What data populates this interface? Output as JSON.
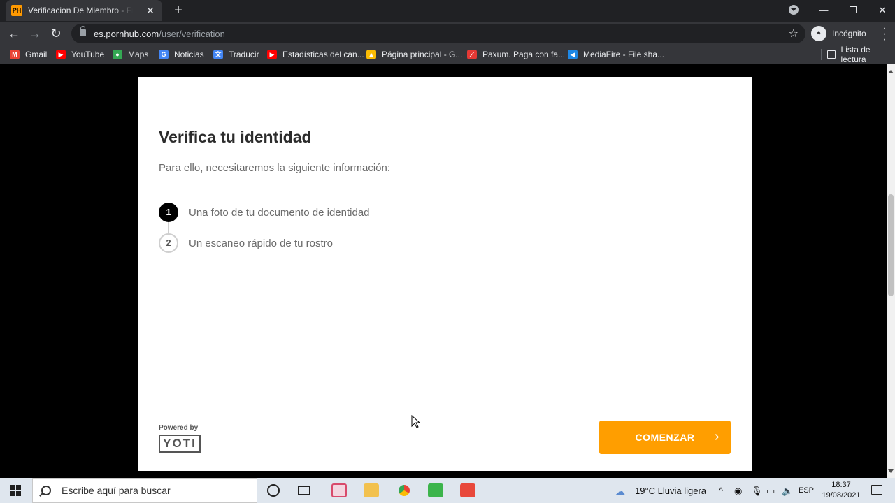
{
  "browser": {
    "tab": {
      "favicon": "PH",
      "title": "Verificacion De Miembro - Free Porn",
      "close": "✕"
    },
    "new_tab": "+",
    "window_controls": {
      "minimize": "—",
      "restore": "❐",
      "close": "✕"
    },
    "url": {
      "host": "es.pornhub.com",
      "path": "/user/verification"
    },
    "profile_label": "Incógnito",
    "bookmarks": [
      {
        "label": "Gmail",
        "color": "#ea4335",
        "glyph": "M"
      },
      {
        "label": "YouTube",
        "color": "#ff0000",
        "glyph": "▶"
      },
      {
        "label": "Maps",
        "color": "#34a853",
        "glyph": "⬤"
      },
      {
        "label": "Noticias",
        "color": "#4285f4",
        "glyph": "G"
      },
      {
        "label": "Traducir",
        "color": "#4285f4",
        "glyph": "文"
      },
      {
        "label": "Estadísticas del can...",
        "color": "#ff0000",
        "glyph": "▶"
      },
      {
        "label": "Página principal - G...",
        "color": "#fbbc04",
        "glyph": "▲"
      },
      {
        "label": "Paxum. Paga con fa...",
        "color": "#e53935",
        "glyph": "⟋"
      },
      {
        "label": "MediaFire - File sha...",
        "color": "#1e88e5",
        "glyph": "◀"
      }
    ],
    "reading_list": "Lista de lectura"
  },
  "verification": {
    "heading": "Verifica tu identidad",
    "subtitle": "Para ello, necesitaremos la siguiente información:",
    "steps": [
      {
        "number": "1",
        "label": "Una foto de tu documento de identidad"
      },
      {
        "number": "2",
        "label": "Un escaneo rápido de tu rostro"
      }
    ],
    "powered_by": "Powered by",
    "provider_logo": "YOTI",
    "start_button": "COMENZAR",
    "start_chevron": "›"
  },
  "taskbar": {
    "search_placeholder": "Escribe aquí para buscar",
    "weather": "19°C  Lluvia ligera",
    "language": "ESP",
    "time": "18:37",
    "date": "19/08/2021"
  },
  "colors": {
    "accent": "#ff9e00",
    "chrome_dark": "#202124",
    "chrome_toolbar": "#35363a"
  }
}
